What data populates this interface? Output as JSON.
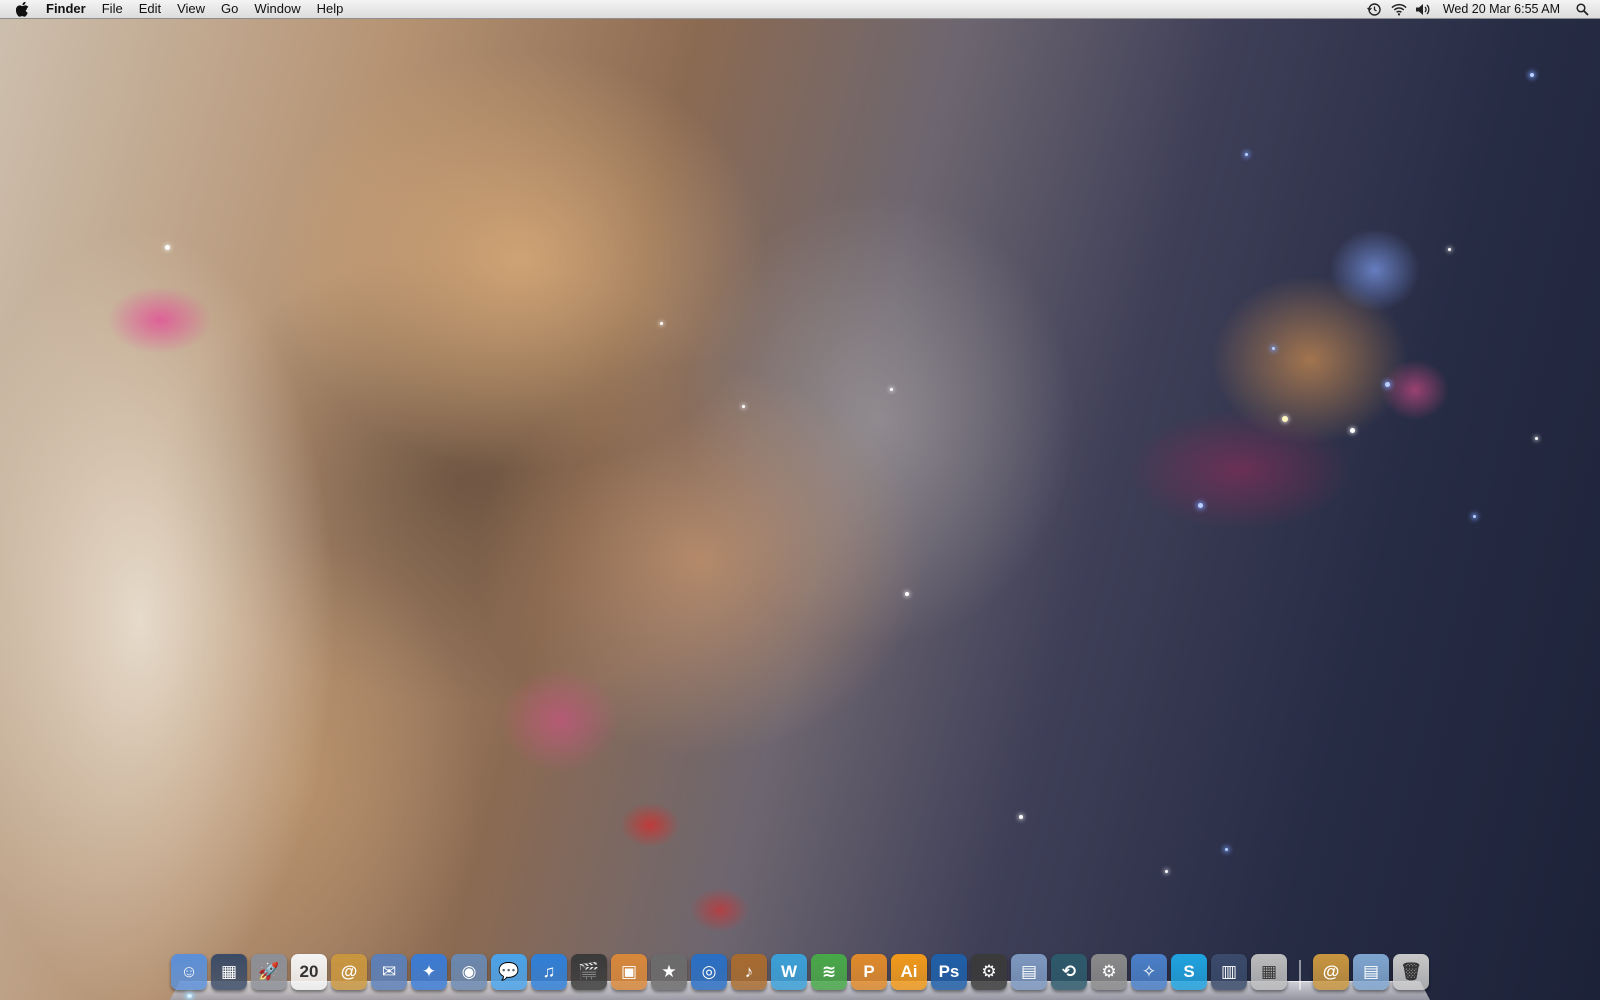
{
  "menubar": {
    "app_name": "Finder",
    "items": [
      "File",
      "Edit",
      "View",
      "Go",
      "Window",
      "Help"
    ],
    "status_icons": [
      "time-machine-icon",
      "wifi-icon",
      "volume-icon"
    ],
    "clock": "Wed 20 Mar 6:55 AM"
  },
  "dock": {
    "apps": [
      {
        "name": "Finder",
        "icon": "finder-icon",
        "glyph": "☺",
        "color": "#5b8fd8",
        "running": true
      },
      {
        "name": "Mission Control",
        "icon": "mission-control-icon",
        "glyph": "▦",
        "color": "#3b4b66",
        "running": false
      },
      {
        "name": "Launchpad",
        "icon": "launchpad-icon",
        "glyph": "🚀",
        "color": "#8c8f96",
        "running": false
      },
      {
        "name": "Calendar",
        "icon": "calendar-icon",
        "glyph": "20",
        "color": "#f4f4f4",
        "running": false
      },
      {
        "name": "Contacts",
        "icon": "contacts-icon",
        "glyph": "@",
        "color": "#c9963f",
        "running": false
      },
      {
        "name": "Preview",
        "icon": "preview-icon",
        "glyph": "✉",
        "color": "#5b7fb8",
        "running": false
      },
      {
        "name": "Safari",
        "icon": "safari-icon",
        "glyph": "✦",
        "color": "#3a7bd5",
        "running": false
      },
      {
        "name": "Photo Booth",
        "icon": "photo-booth-icon",
        "glyph": "◉",
        "color": "#6a88b0",
        "running": false
      },
      {
        "name": "Messages",
        "icon": "messages-icon",
        "glyph": "💬",
        "color": "#4aa3ea",
        "running": false
      },
      {
        "name": "iTunes",
        "icon": "itunes-icon",
        "glyph": "♫",
        "color": "#2f7fd8",
        "running": false
      },
      {
        "name": "iMovie",
        "icon": "imovie-icon",
        "glyph": "🎬",
        "color": "#3a3a3a",
        "running": false
      },
      {
        "name": "iPhoto",
        "icon": "iphoto-icon",
        "glyph": "▣",
        "color": "#d8883a",
        "running": false
      },
      {
        "name": "iMovie Star",
        "icon": "star-icon",
        "glyph": "★",
        "color": "#6b6b6b",
        "running": false
      },
      {
        "name": "iDVD",
        "icon": "idvd-icon",
        "glyph": "◎",
        "color": "#2a6fc4",
        "running": false
      },
      {
        "name": "GarageBand",
        "icon": "garageband-icon",
        "glyph": "♪",
        "color": "#a86b2e",
        "running": false
      },
      {
        "name": "iWeb",
        "icon": "iweb-icon",
        "glyph": "W",
        "color": "#3aa0d8",
        "running": false
      },
      {
        "name": "Numbers",
        "icon": "numbers-icon",
        "glyph": "≋",
        "color": "#48a848",
        "running": false
      },
      {
        "name": "Pages",
        "icon": "pages-icon",
        "glyph": "P",
        "color": "#e08a2a",
        "running": false
      },
      {
        "name": "Adobe Illustrator",
        "icon": "illustrator-icon",
        "glyph": "Ai",
        "color": "#f29a1a",
        "running": false
      },
      {
        "name": "Adobe Photoshop",
        "icon": "photoshop-icon",
        "glyph": "Ps",
        "color": "#1f5fa8",
        "running": false
      },
      {
        "name": "Aperture",
        "icon": "aperture-icon",
        "glyph": "⚙",
        "color": "#3a3a3a",
        "running": false
      },
      {
        "name": "Preview Files",
        "icon": "preview-files-icon",
        "glyph": "▤",
        "color": "#7d98c0",
        "running": false
      },
      {
        "name": "Time Machine",
        "icon": "time-machine-icon",
        "glyph": "⟲",
        "color": "#2d5a6b",
        "running": false
      },
      {
        "name": "System Preferences",
        "icon": "system-preferences-icon",
        "glyph": "⚙",
        "color": "#8a8a8a",
        "running": false
      },
      {
        "name": "Dashboard",
        "icon": "dashboard-icon",
        "glyph": "✧",
        "color": "#4a7fc8",
        "running": false
      },
      {
        "name": "Skype",
        "icon": "skype-icon",
        "glyph": "S",
        "color": "#1fa3e0",
        "running": false
      },
      {
        "name": "Audio MIDI",
        "icon": "piano-icon",
        "glyph": "▥",
        "color": "#3a4a6a",
        "running": false
      },
      {
        "name": "Calculator",
        "icon": "calculator-icon",
        "glyph": "▦",
        "color": "#bcbcbc",
        "running": false
      }
    ],
    "stacks": [
      {
        "name": "Applications",
        "icon": "applications-folder-icon",
        "glyph": "@",
        "color": "#c9963f"
      },
      {
        "name": "Downloads",
        "icon": "downloads-folder-icon",
        "glyph": "▤",
        "color": "#7fa6d0"
      },
      {
        "name": "Trash",
        "icon": "trash-icon",
        "glyph": "🗑",
        "color": "#c8c8c8"
      }
    ]
  }
}
